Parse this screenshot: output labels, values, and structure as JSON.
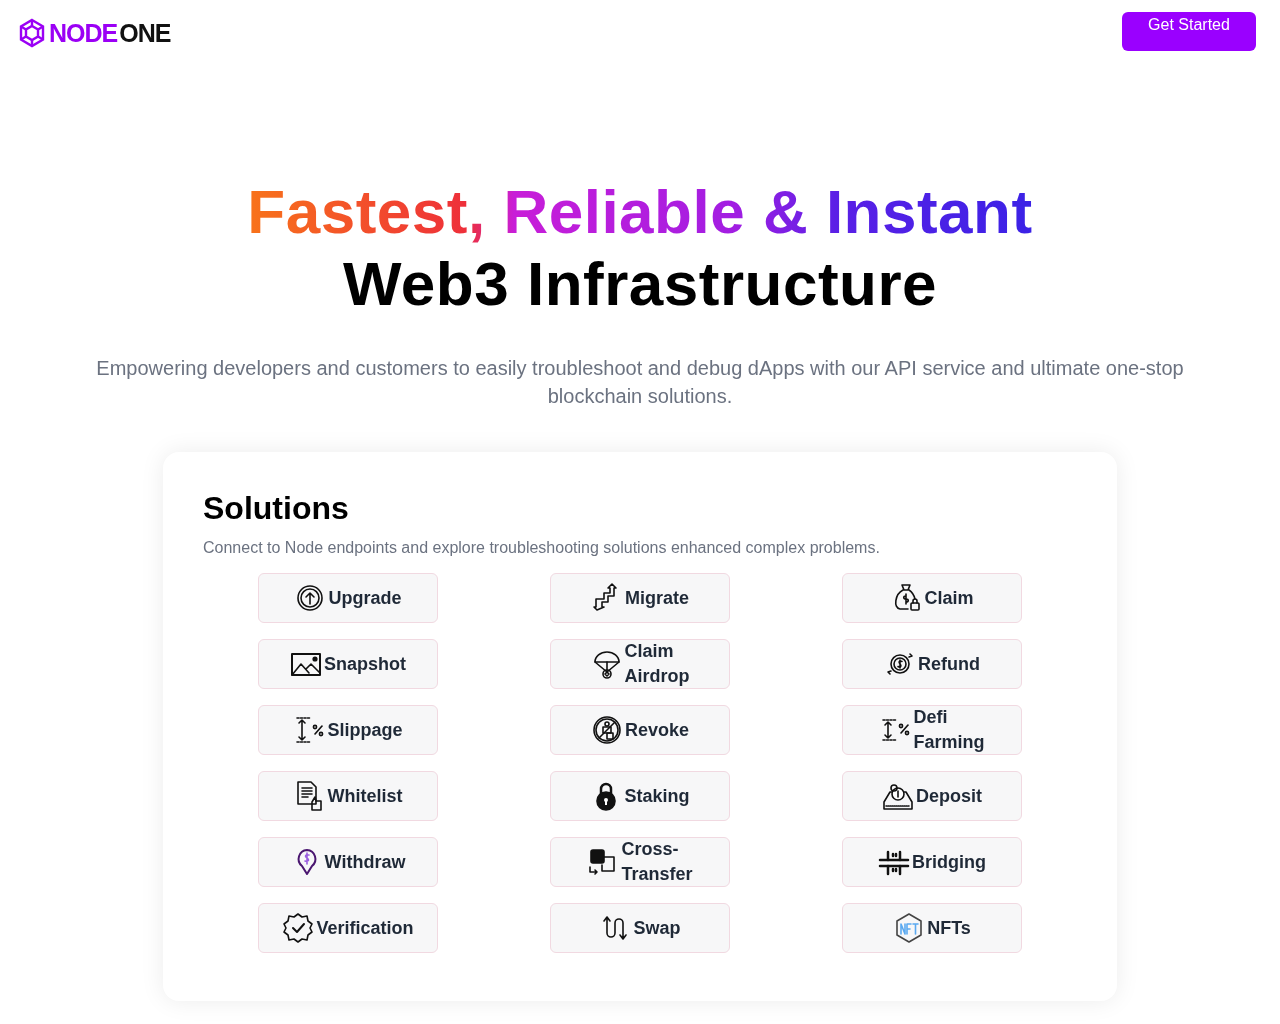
{
  "header": {
    "logo": {
      "primary": "NODE",
      "secondary": "ONE"
    },
    "cta": "Get Started"
  },
  "hero": {
    "headline": "Fastest, Reliable & Instant",
    "headline_2": "Web3 Infrastructure",
    "subtitle": "Empowering developers and customers to easily troubleshoot and debug dApps with our API service and ultimate one-stop blockchain solutions."
  },
  "solutions": {
    "title": "Solutions",
    "subtitle": "Connect to Node endpoints and explore troubleshooting solutions enhanced complex problems.",
    "items": [
      {
        "label": "Upgrade"
      },
      {
        "label": "Migrate"
      },
      {
        "label": "Claim"
      },
      {
        "label": "Snapshot"
      },
      {
        "label": "Claim Airdrop"
      },
      {
        "label": "Refund"
      },
      {
        "label": "Slippage"
      },
      {
        "label": "Revoke"
      },
      {
        "label": "Defi Farming"
      },
      {
        "label": "Whitelist"
      },
      {
        "label": "Staking"
      },
      {
        "label": "Deposit"
      },
      {
        "label": "Withdraw"
      },
      {
        "label": "Cross-Transfer"
      },
      {
        "label": "Bridging"
      },
      {
        "label": "Verification"
      },
      {
        "label": "Swap"
      },
      {
        "label": "NFTs"
      }
    ]
  }
}
